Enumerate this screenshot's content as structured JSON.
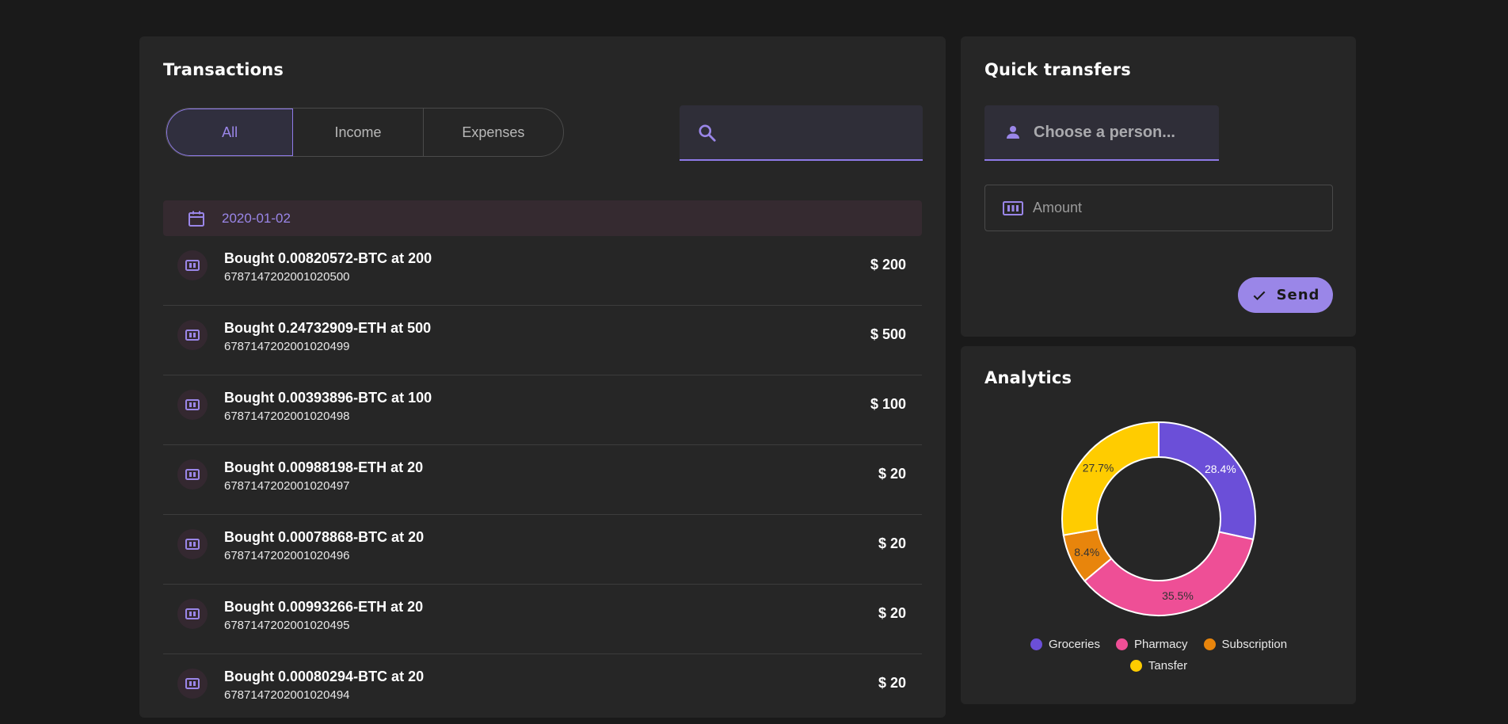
{
  "transactions": {
    "title": "Transactions",
    "filters": [
      "All",
      "Income",
      "Expenses"
    ],
    "search_placeholder": "",
    "date": "2020-01-02",
    "items": [
      {
        "title": "Bought 0.00820572-BTC at 200",
        "id": "6787147202001020500",
        "amount": "$ 200"
      },
      {
        "title": "Bought 0.24732909-ETH at 500",
        "id": "6787147202001020499",
        "amount": "$ 500"
      },
      {
        "title": "Bought 0.00393896-BTC at 100",
        "id": "6787147202001020498",
        "amount": "$ 100"
      },
      {
        "title": "Bought 0.00988198-ETH at 20",
        "id": "6787147202001020497",
        "amount": "$ 20"
      },
      {
        "title": "Bought 0.00078868-BTC at 20",
        "id": "6787147202001020496",
        "amount": "$ 20"
      },
      {
        "title": "Bought 0.00993266-ETH at 20",
        "id": "6787147202001020495",
        "amount": "$ 20"
      },
      {
        "title": "Bought 0.00080294-BTC at 20",
        "id": "6787147202001020494",
        "amount": "$ 20"
      }
    ]
  },
  "quick_transfers": {
    "title": "Quick transfers",
    "person_placeholder": "Choose a person...",
    "amount_placeholder": "Amount",
    "send_label": "Send"
  },
  "analytics": {
    "title": "Analytics",
    "chart_data": {
      "type": "pie",
      "categories": [
        "Groceries",
        "Pharmacy",
        "Subscription",
        "Tansfer"
      ],
      "values": [
        28.4,
        35.5,
        8.4,
        27.7
      ],
      "labels": [
        "28.4%",
        "35.5%",
        "8.4%",
        "27.7%"
      ],
      "colors": [
        "#6b4fd8",
        "#ee4f96",
        "#e8850c",
        "#ffcc00"
      ],
      "legend": "bottom"
    }
  },
  "colors": {
    "accent": "#9a86e8",
    "background": "#1a1a1a",
    "card": "#262626"
  }
}
